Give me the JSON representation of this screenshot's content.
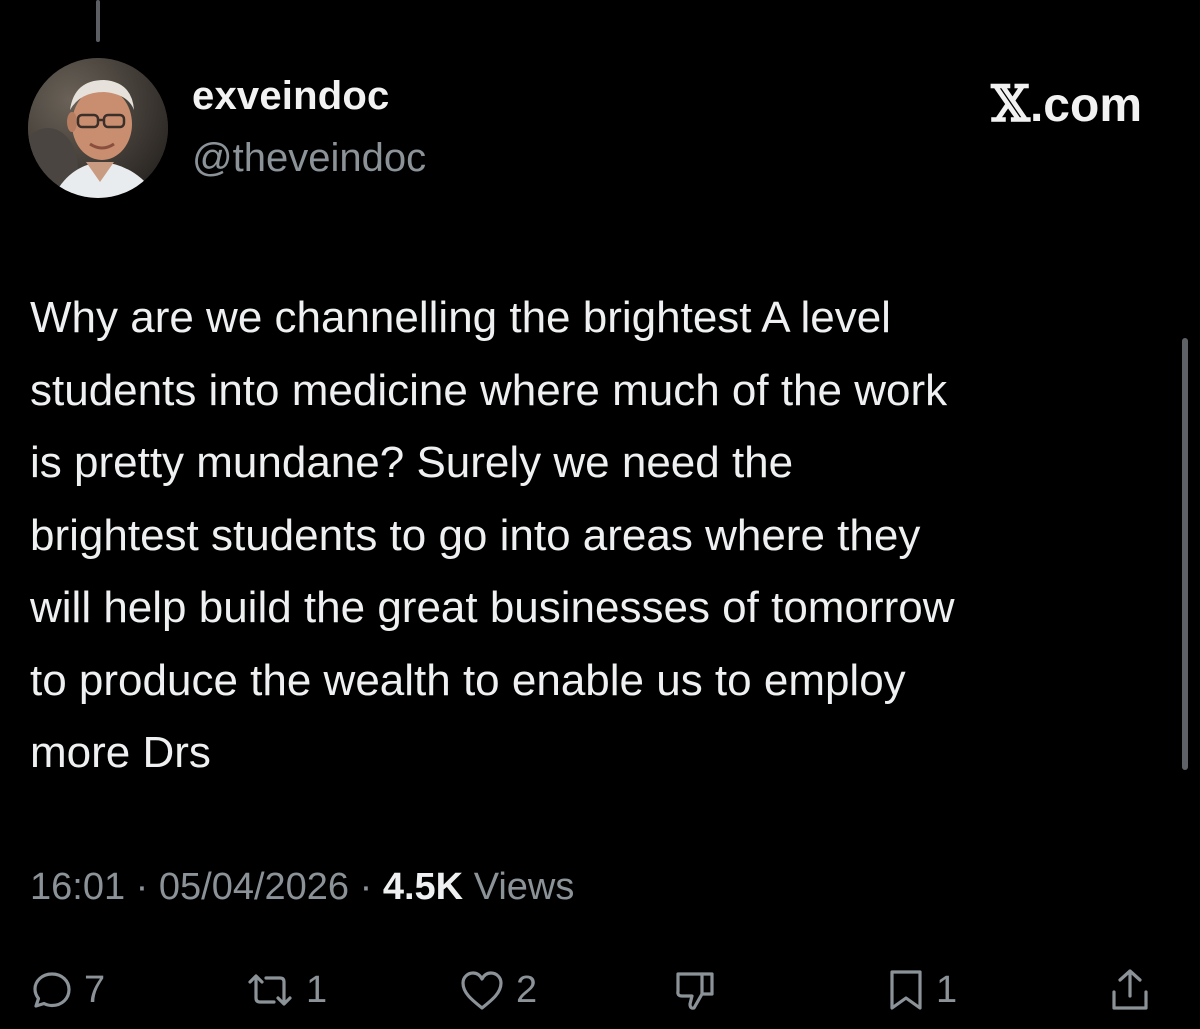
{
  "author": {
    "display_name": "exveindoc",
    "handle": "@theveindoc",
    "avatar_icon": "avatar-photo"
  },
  "site": {
    "logo_mark": "𝕏",
    "logo_text": ".com"
  },
  "tweet": {
    "text": "Why are we channelling the brightest A level\nstudents into medicine where much of the work\nis pretty mundane? Surely we need the\nbrightest students to go into areas where they\nwill help build the great businesses of tomorrow\nto produce the wealth to enable us to employ\nmore Drs",
    "time": "16:01",
    "separator": "·",
    "date": "05/04/2026",
    "views_count": "4.5K",
    "views_label": "Views"
  },
  "actions": {
    "reply": {
      "icon": "reply-icon",
      "count": "7"
    },
    "repost": {
      "icon": "repost-icon",
      "count": "1"
    },
    "like": {
      "icon": "heart-icon",
      "count": "2"
    },
    "dislike": {
      "icon": "thumbs-down-icon"
    },
    "bookmark": {
      "icon": "bookmark-icon",
      "count": "1"
    },
    "share": {
      "icon": "share-icon"
    }
  },
  "colors": {
    "background": "#000000",
    "primary_text": "#e7e9ea",
    "secondary_text": "#8b9298"
  }
}
